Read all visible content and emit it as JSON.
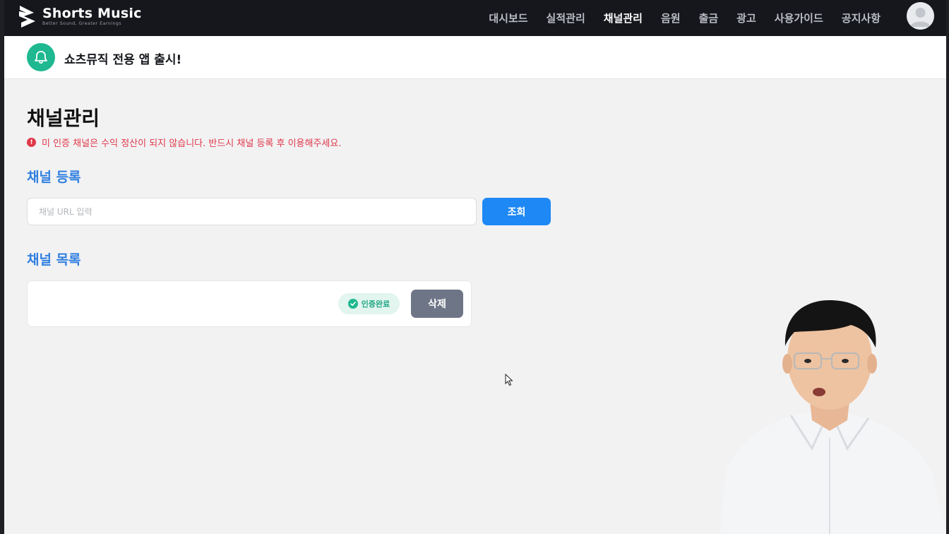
{
  "brand": {
    "name": "Shorts Music",
    "tagline": "Better Sound, Greater Earnings"
  },
  "nav": {
    "items": [
      {
        "label": "대시보드",
        "active": false
      },
      {
        "label": "실적관리",
        "active": false
      },
      {
        "label": "채널관리",
        "active": true
      },
      {
        "label": "음원",
        "active": false
      },
      {
        "label": "출금",
        "active": false
      },
      {
        "label": "광고",
        "active": false
      },
      {
        "label": "사용가이드",
        "active": false
      },
      {
        "label": "공지사항",
        "active": false
      }
    ],
    "avatar_icon": "user-avatar-icon"
  },
  "notice": {
    "icon": "bell-icon",
    "text": "쇼츠뮤직 전용 앱 출시!"
  },
  "page": {
    "title": "채널관리",
    "warning": "미 인증 채널은 수익 정산이 되지 않습니다. 반드시 채널 등록 후 이용해주세요."
  },
  "register": {
    "title": "채널 등록",
    "input_placeholder": "채널 URL 입력",
    "input_value": "",
    "search_label": "조회"
  },
  "channel_list": {
    "title": "채널 목록",
    "items": [
      {
        "name": "",
        "status": "인증완료",
        "delete_label": "삭제"
      }
    ]
  },
  "colors": {
    "nav_bg": "#15171c",
    "accent_blue": "#1e88f5",
    "accent_green": "#1fb890",
    "warning_red": "#e0384a",
    "delete_gray": "#6e7587"
  }
}
